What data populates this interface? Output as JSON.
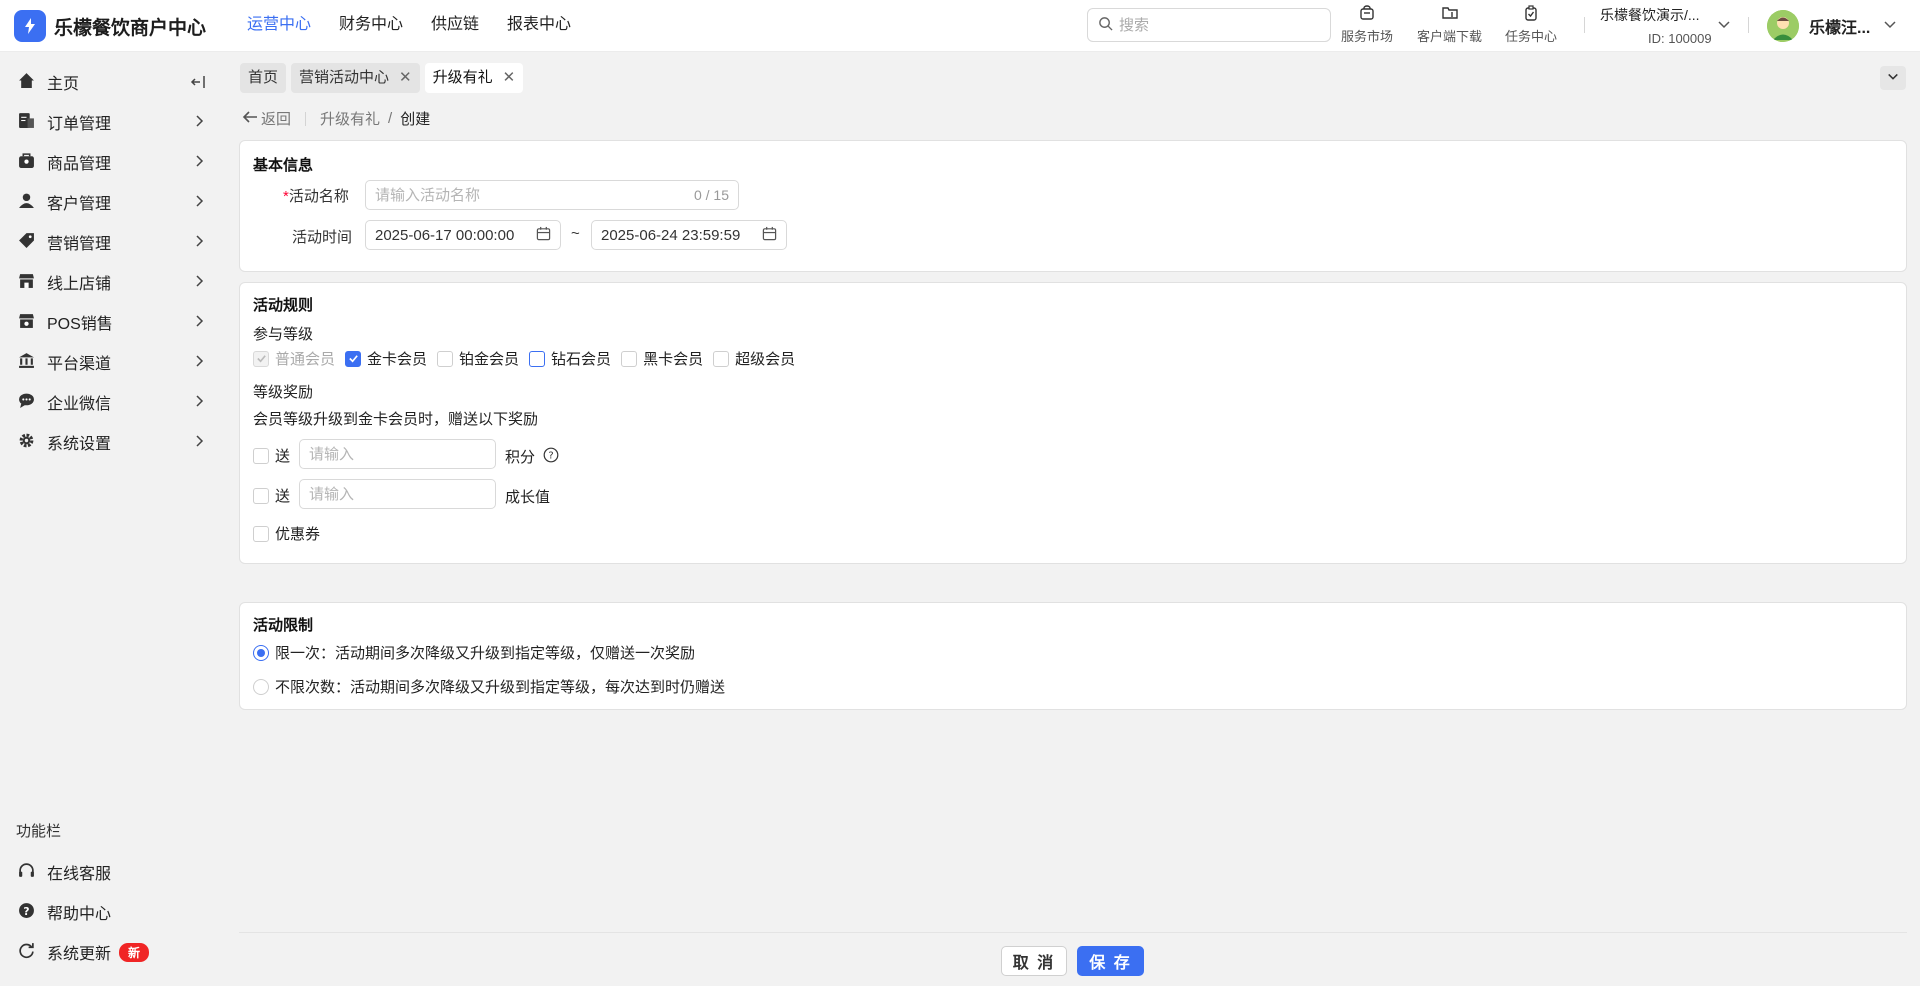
{
  "app": {
    "title": "乐檬餐饮商户中心"
  },
  "topnav": [
    "运营中心",
    "财务中心",
    "供应链",
    "报表中心"
  ],
  "search": {
    "placeholder": "搜索"
  },
  "tools": {
    "market": "服务市场",
    "download": "客户端下载",
    "tasks": "任务中心"
  },
  "account": {
    "name": "乐檬餐饮演示/...",
    "id": "ID: 100009"
  },
  "user": {
    "name": "乐檬汪..."
  },
  "sidebar": {
    "items": [
      "主页",
      "订单管理",
      "商品管理",
      "客户管理",
      "营销管理",
      "线上店铺",
      "POS销售",
      "平台渠道",
      "企业微信",
      "系统设置"
    ],
    "func_title": "功能栏",
    "func_items": [
      "在线客服",
      "帮助中心",
      "系统更新"
    ],
    "new_badge": "新"
  },
  "tabs": [
    "首页",
    "营销活动中心",
    "升级有礼"
  ],
  "breadcrumb": {
    "back": "返回",
    "parent": "升级有礼",
    "sep": "/",
    "current": "创建"
  },
  "basic": {
    "title": "基本信息",
    "name_label": "活动名称",
    "name_placeholder": "请输入活动名称",
    "name_counter": "0 / 15",
    "time_label": "活动时间",
    "start": "2025-06-17 00:00:00",
    "tilde": "~",
    "end": "2025-06-24 23:59:59"
  },
  "rules": {
    "title": "活动规则",
    "level_label": "参与等级",
    "levels": [
      "普通会员",
      "金卡会员",
      "铂金会员",
      "钻石会员",
      "黑卡会员",
      "超级会员"
    ],
    "reward_label": "等级奖励",
    "reward_desc": "会员等级升级到金卡会员时，赠送以下奖励",
    "give": "送",
    "input_placeholder": "请输入",
    "points": "积分",
    "growth": "成长值",
    "coupon": "优惠券"
  },
  "limit": {
    "title": "活动限制",
    "once": "限一次：活动期间多次降级又升级到指定等级，仅赠送一次奖励",
    "unlimited": "不限次数：活动期间多次降级又升级到指定等级，每次达到时仍赠送"
  },
  "buttons": {
    "cancel": "取 消",
    "save": "保 存"
  },
  "colors": {
    "primary": "#3b6ff2",
    "badge": "#f02525"
  }
}
